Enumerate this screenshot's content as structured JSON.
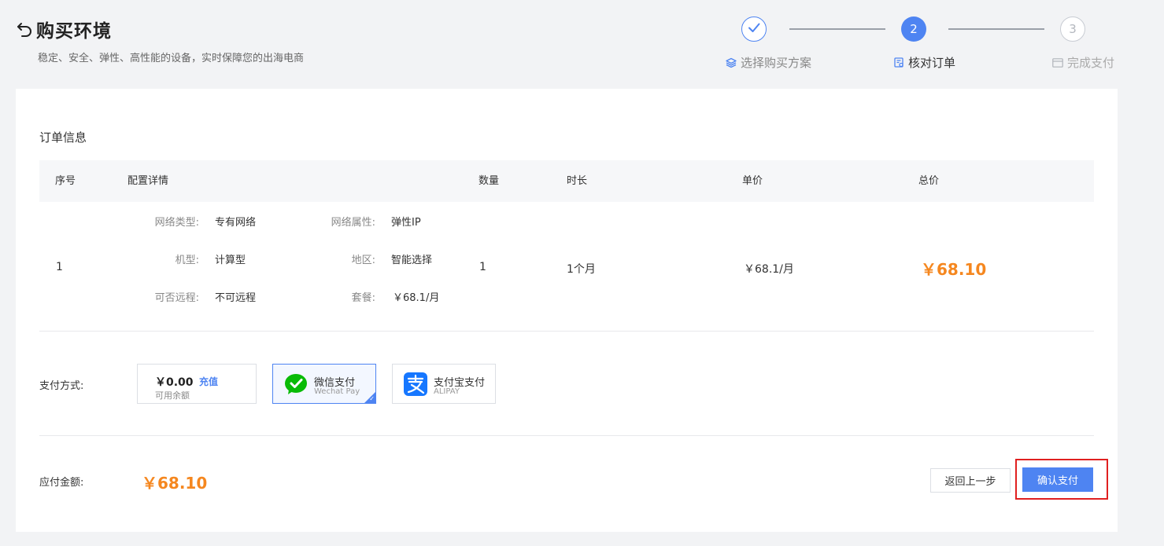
{
  "header": {
    "title": "购买环境",
    "subtitle": "稳定、安全、弹性、高性能的设备，实时保障您的出海电商"
  },
  "steps": [
    {
      "number": "1",
      "label": "选择购买方案",
      "status": "done"
    },
    {
      "number": "2",
      "label": "核对订单",
      "status": "active"
    },
    {
      "number": "3",
      "label": "完成支付",
      "status": "pending"
    }
  ],
  "order": {
    "section_title": "订单信息",
    "columns": [
      "序号",
      "配置详情",
      "数量",
      "时长",
      "单价",
      "总价"
    ],
    "row": {
      "index": "1",
      "details": [
        {
          "label": "网络类型:",
          "value": "专有网络"
        },
        {
          "label": "网络属性:",
          "value": "弹性IP"
        },
        {
          "label": "机型:",
          "value": "计算型"
        },
        {
          "label": "地区:",
          "value": "智能选择"
        },
        {
          "label": "可否远程:",
          "value": "不可远程"
        },
        {
          "label": "套餐:",
          "value": "￥68.1/月"
        }
      ],
      "quantity": "1",
      "duration": "1个月",
      "unit_price": "￥68.1/月",
      "total_price": "￥68.10"
    }
  },
  "payment": {
    "label": "支付方式:",
    "balance": {
      "amount": "￥0.00",
      "recharge": "充值",
      "caption": "可用余额"
    },
    "wechat": {
      "name": "微信支付",
      "subtitle": "Wechat Pay",
      "selected": true
    },
    "alipay": {
      "name": "支付宝支付",
      "subtitle": "ALIPAY",
      "selected": false
    },
    "check_mark": "✓"
  },
  "summary": {
    "due_label": "应付金额:",
    "due_amount": "￥68.10"
  },
  "actions": {
    "back_label": "返回上一步",
    "confirm_label": "确认支付"
  },
  "colors": {
    "accent": "#4e84f2",
    "price": "#f5871f",
    "highlight_frame": "#e02020",
    "wechat_green": "#09bb07",
    "alipay_blue": "#1677ff"
  },
  "icons": {
    "back": "back-arrow-icon",
    "step1": "layers-icon",
    "step2": "order-check-icon",
    "step3": "payment-card-icon",
    "step_done": "check-icon",
    "wechat": "wechat-pay-icon",
    "alipay": "alipay-icon"
  }
}
